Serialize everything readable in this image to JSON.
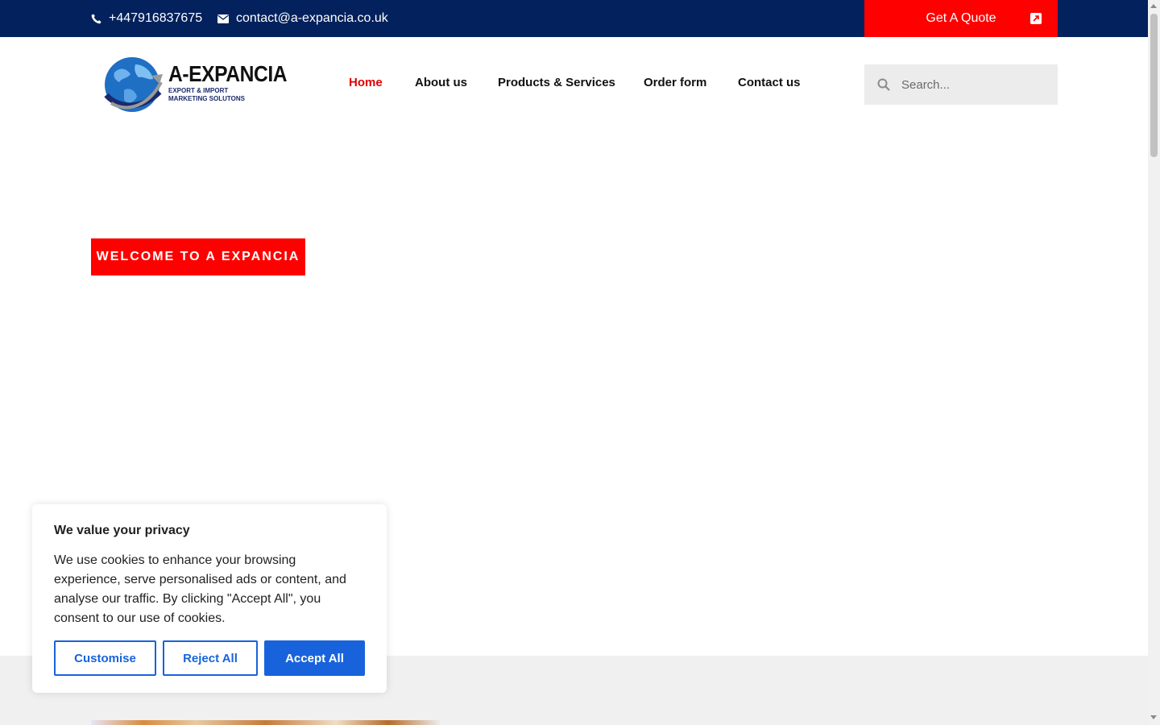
{
  "topbar": {
    "phone": "+447916837675",
    "email": "contact@a-expancia.co.uk",
    "quote_label": "Get A Quote",
    "background": "#03215c",
    "accent": "#ff0000"
  },
  "logo": {
    "name": "A-EXPANCIA",
    "tagline_1": "EXPORT & IMPORT",
    "tagline_2": "MARKETING SOLUTONS"
  },
  "nav": [
    {
      "label": "Home",
      "active": true
    },
    {
      "label": "About us",
      "active": false
    },
    {
      "label": "Products & Services",
      "active": false
    },
    {
      "label": "Order form",
      "active": false
    },
    {
      "label": "Contact us",
      "active": false
    }
  ],
  "search": {
    "placeholder": "Search..."
  },
  "hero": {
    "welcome": "WELCOME TO A EXPANCIA"
  },
  "cookie": {
    "title": "We value your privacy",
    "text": "We use cookies to enhance your browsing experience, serve personalised ads or content, and analyse our traffic. By clicking \"Accept All\", you consent to our use of cookies.",
    "customise": "Customise",
    "reject": "Reject All",
    "accept": "Accept All",
    "accent": "#1863dc"
  },
  "icons": {
    "phone": "phone-icon",
    "email": "envelope-icon",
    "quote": "external-link-icon",
    "search": "search-icon"
  }
}
